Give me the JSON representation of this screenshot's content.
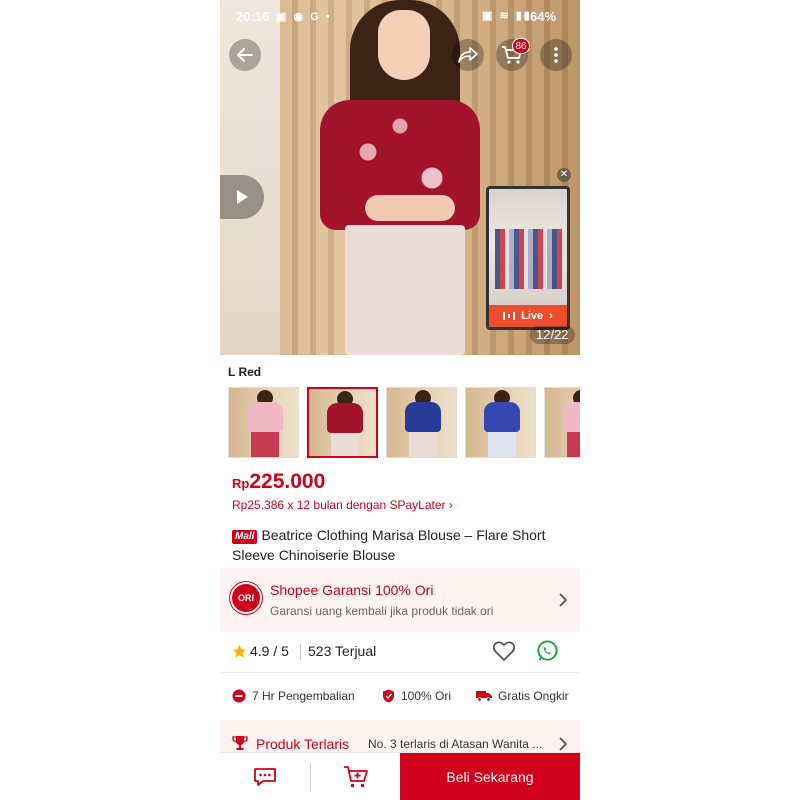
{
  "status_bar": {
    "time": "20:16",
    "left_icons": "▣ ◉ G •",
    "right_icons": "▣ ≋ ▮▮",
    "battery": "64%"
  },
  "hero": {
    "cart_count": "86",
    "image_counter": "12/22",
    "live_label": "Live",
    "icons": [
      "back-arrow-icon",
      "share-icon",
      "cart-icon",
      "more-vertical-icon",
      "play-icon",
      "close-icon"
    ]
  },
  "variant": {
    "label": "L Red"
  },
  "price": {
    "currency": "Rp",
    "amount": "225.000",
    "installment": "Rp25.386 x 12 bulan dengan SPayLater ›"
  },
  "product": {
    "mall_badge": "Mall",
    "title": "Beatrice Clothing Marisa Blouse – Flare Short Sleeve Chinoiserie Blouse"
  },
  "garansi": {
    "icon_text": "ORI",
    "title": "Shopee Garansi 100% Ori",
    "subtitle": "Garansi uang kembali jika produk tidak ori"
  },
  "stats": {
    "rating": "4.9 / 5",
    "sold": "523 Terjual"
  },
  "features": [
    {
      "label": "7 Hr Pengembalian"
    },
    {
      "label": "100% Ori"
    },
    {
      "label": "Gratis Ongkir"
    }
  ],
  "terlaris": {
    "title": "Produk Terlaris",
    "description": "No. 3 terlaris di Atasan Wanita ..."
  },
  "bottom_bar": {
    "buy_label": "Beli Sekarang"
  },
  "colors": {
    "brand_red": "#d0011b",
    "light_pink": "#fff4f2",
    "live_orange": "#ee4d2d"
  }
}
